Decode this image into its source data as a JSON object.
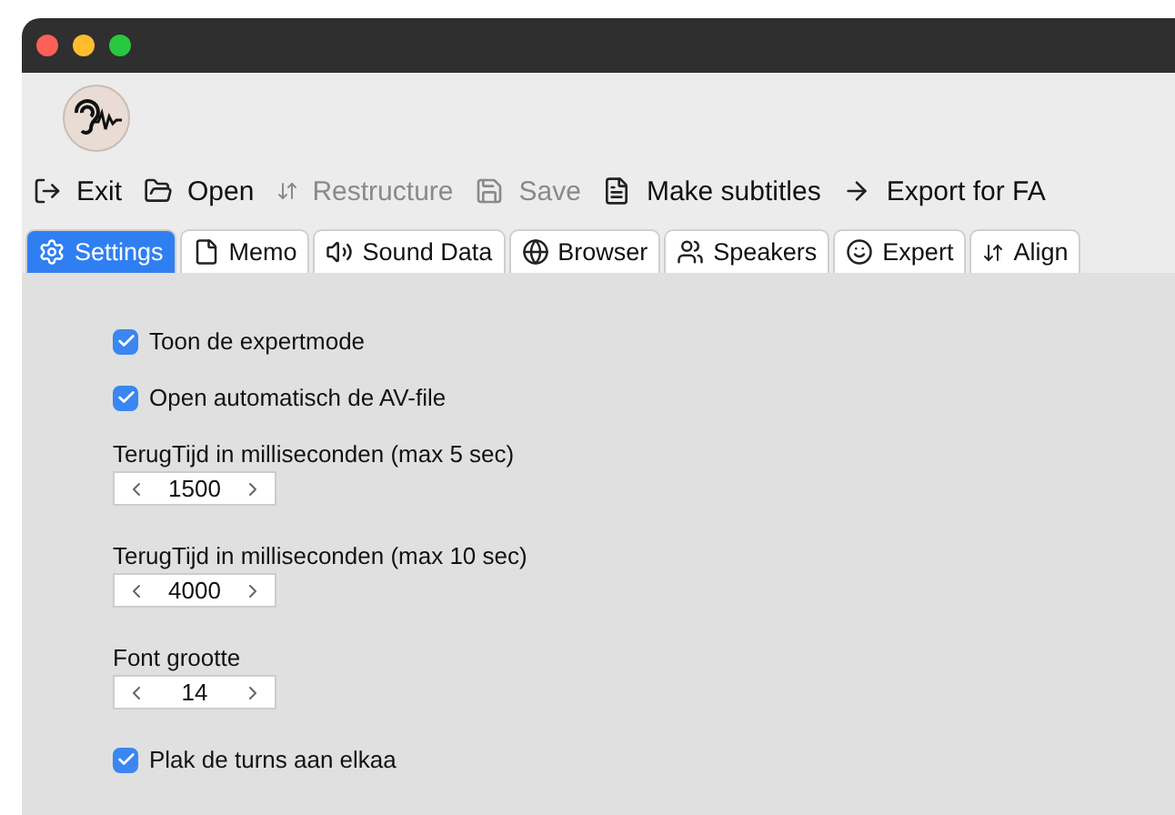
{
  "toolbar": [
    {
      "label": "Exit",
      "disabled": false
    },
    {
      "label": "Open",
      "disabled": false
    },
    {
      "label": "Restructure",
      "disabled": true
    },
    {
      "label": "Save",
      "disabled": true
    },
    {
      "label": "Make subtitles",
      "disabled": false
    },
    {
      "label": "Export for FA",
      "disabled": false
    }
  ],
  "tabs": [
    {
      "label": "Settings",
      "selected": true
    },
    {
      "label": "Memo",
      "selected": false
    },
    {
      "label": "Sound Data",
      "selected": false
    },
    {
      "label": "Browser",
      "selected": false
    },
    {
      "label": "Speakers",
      "selected": false
    },
    {
      "label": "Expert",
      "selected": false
    },
    {
      "label": "Align",
      "selected": false
    }
  ],
  "settings": [
    {
      "kind": "checkbox",
      "label": "Toon de expertmode",
      "checked": true
    },
    {
      "kind": "checkbox",
      "label": "Open automatisch de AV-file",
      "checked": true
    },
    {
      "kind": "spinner",
      "label": "TerugTijd in milliseconden (max 5 sec)",
      "value": "1500"
    },
    {
      "kind": "spinner",
      "label": "TerugTijd in milliseconden (max 10 sec)",
      "value": "4000"
    },
    {
      "kind": "spinner",
      "label": "Font grootte",
      "value": "14"
    },
    {
      "kind": "checkbox",
      "label": "Plak de turns aan elkaa",
      "checked": true
    }
  ]
}
